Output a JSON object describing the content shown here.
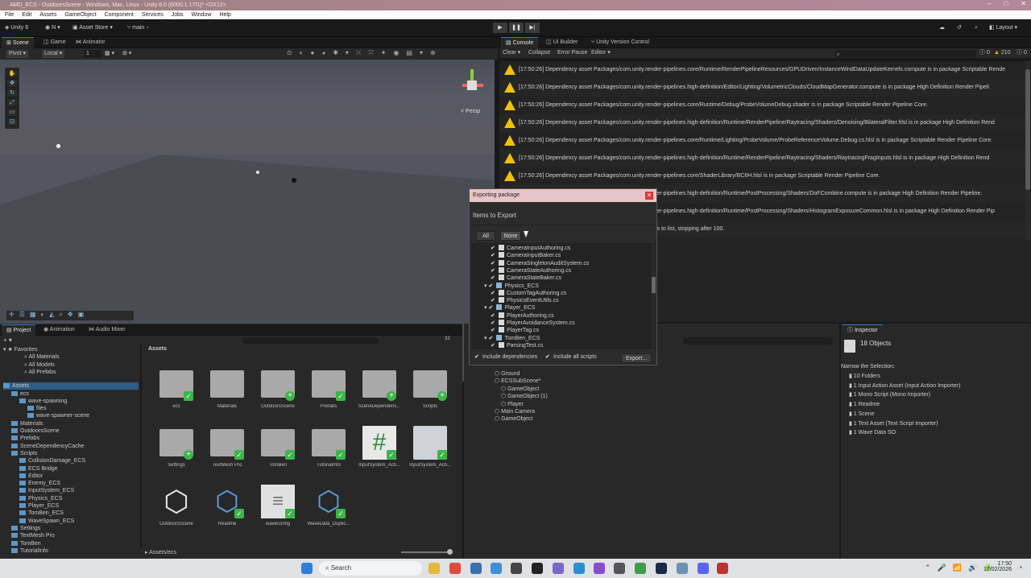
{
  "window": {
    "title": "AMD_ECS - OutdoorsScene - Windows, Mac, Linux - Unity 6.0 (6000.1.17f1)* <DX12>"
  },
  "menu": [
    "File",
    "Edit",
    "Assets",
    "GameObject",
    "Component",
    "Services",
    "Jobs",
    "Window",
    "Help"
  ],
  "toolbar": {
    "unity": "Unity 6",
    "account": "N",
    "asset_store": "Asset Store",
    "branch": "main",
    "layout": "Layout"
  },
  "scene_tabs": [
    "Scene",
    "Game",
    "Animator"
  ],
  "scene_toolbar": {
    "pivot": "Pivot",
    "local": "Local",
    "grid": "1",
    "persp": "< Persp"
  },
  "console": {
    "tabs": [
      "Console",
      "UI Builder",
      "Unity Version Control"
    ],
    "buttons": [
      "Clear",
      "Collapse",
      "Error Pause",
      "Editor"
    ],
    "counts": {
      "info": "0",
      "warn": "210",
      "error": "0"
    },
    "logs": [
      "[17:50:26] Dependency asset Packages/com.unity.render-pipelines.core/Runtime/RenderPipelineResources/GPUDriven/InstanceWindDataUpdateKernels.compute is in package Scriptable Rende",
      "[17:50:26] Dependency asset Packages/com.unity.render-pipelines.high-definition/Editor/Lighting/VolumetricClouds/CloudMapGenerator.compute is in package High Definition Render Pipeli",
      "[17:50:26] Dependency asset Packages/com.unity.render-pipelines.core/Runtime/Debug/ProbeVolumeDebug.shader is in package Scriptable Render Pipeline Core.",
      "[17:50:26] Dependency asset Packages/com.unity.render-pipelines.high-definition/Runtime/RenderPipeline/Raytracing/Shaders/Denoising/BilateralFilter.hlsl is in package High Definition Rend",
      "[17:50:26] Dependency asset Packages/com.unity.render-pipelines.core/Runtime/Lighting/ProbeVolume/ProbeReferenceVolume.Debug.cs.hlsl is in package Scriptable Render Pipeline Core.",
      "[17:50:26] Dependency asset Packages/com.unity.render-pipelines.high-definition/Runtime/RenderPipeline/Raytracing/Shaders/RaytracingFragInputs.hlsl is in package High Definition Rend",
      "[17:50:26] Dependency asset Packages/com.unity.render-pipelines.core/ShaderLibrary/BC6H.hlsl is in package Scriptable Render Pipeline Core.",
      "[17:50:26] Dependency asset Packages/com.unity.render-pipelines.high-definition/Runtime/PostProcessing/Shaders/DoFCombine.compute is in package High Definition Render Pipeline.",
      "[17:50:26] Dependency asset Packages/com.unity.render-pipelines.high-definition/Runtime/PostProcessing/Shaders/HistogramExposureCommon.hlsl is in package High Definition Render Pip",
      "[17:50:26] Dependency asset ... too many dependencies to list, stopping after 100."
    ]
  },
  "dialog": {
    "title": "Exporting package",
    "heading": "Items to Export",
    "all": "All",
    "none": "None",
    "rows": [
      {
        "label": "CameraInputAuthoring.cs",
        "indent": 3,
        "folder": false
      },
      {
        "label": "CameraInputBaker.cs",
        "indent": 3,
        "folder": false
      },
      {
        "label": "CameraSingletonAuditSystem.cs",
        "indent": 3,
        "folder": false
      },
      {
        "label": "CameraStateAuthoring.cs",
        "indent": 3,
        "folder": false
      },
      {
        "label": "CameraStateBaker.cs",
        "indent": 3,
        "folder": false
      },
      {
        "label": "Physics_ECS",
        "indent": 2,
        "folder": true
      },
      {
        "label": "CustomTagAuthoring.cs",
        "indent": 3,
        "folder": false
      },
      {
        "label": "PhysicsEventUtils.cs",
        "indent": 3,
        "folder": false
      },
      {
        "label": "Player_ECS",
        "indent": 2,
        "folder": true
      },
      {
        "label": "PlayerAuthoring.cs",
        "indent": 3,
        "folder": false
      },
      {
        "label": "PlayerAvoidanceSystem.cs",
        "indent": 3,
        "folder": false
      },
      {
        "label": "PlayerTag.cs",
        "indent": 3,
        "folder": false
      },
      {
        "label": "TomBen_ECS",
        "indent": 2,
        "folder": true
      },
      {
        "label": "ParsingTest.cs",
        "indent": 3,
        "folder": false
      }
    ],
    "include_deps": "Include dependencies",
    "include_scripts": "Include all scripts",
    "export": "Export..."
  },
  "project": {
    "tabs": [
      "Project",
      "Animation",
      "Audio Mixer"
    ],
    "favorites": "Favorites",
    "fav_items": [
      "All Materials",
      "All Models",
      "All Prefabs"
    ],
    "tree": [
      {
        "label": "Assets",
        "indent": 0
      },
      {
        "label": "ecs",
        "indent": 1
      },
      {
        "label": "wave-spawning",
        "indent": 2
      },
      {
        "label": "files",
        "indent": 3
      },
      {
        "label": "wave-spawner-scene",
        "indent": 3
      },
      {
        "label": "Materials",
        "indent": 1
      },
      {
        "label": "OutdoorsScene",
        "indent": 1
      },
      {
        "label": "Prefabs",
        "indent": 1
      },
      {
        "label": "SceneDependencyCache",
        "indent": 1
      },
      {
        "label": "Scripts",
        "indent": 1
      },
      {
        "label": "CollisionDamage_ECS",
        "indent": 2
      },
      {
        "label": "ECS Bridge",
        "indent": 2
      },
      {
        "label": "Editor",
        "indent": 2
      },
      {
        "label": "Enemy_ECS",
        "indent": 2
      },
      {
        "label": "InputSystem_ECS",
        "indent": 2
      },
      {
        "label": "Physics_ECS",
        "indent": 2
      },
      {
        "label": "Player_ECS",
        "indent": 2
      },
      {
        "label": "TomBen_ECS",
        "indent": 2
      },
      {
        "label": "WaveSpawn_ECS",
        "indent": 2
      },
      {
        "label": "Settings",
        "indent": 1
      },
      {
        "label": "TextMesh Pro",
        "indent": 1
      },
      {
        "label": "TomBen",
        "indent": 1
      },
      {
        "label": "TutorialInfo",
        "indent": 1
      }
    ],
    "breadcrumb": "Assets",
    "footer_path": "Assets/ecs",
    "count": "32",
    "assets": [
      {
        "label": "ecs",
        "kind": "folder",
        "badge": "chk"
      },
      {
        "label": "Materials",
        "kind": "folder",
        "badge": ""
      },
      {
        "label": "OutdoorsScene",
        "kind": "folder",
        "badge": "plus"
      },
      {
        "label": "Prefabs",
        "kind": "folder",
        "badge": "chk"
      },
      {
        "label": "SceneDependenc...",
        "kind": "folder",
        "badge": "plus"
      },
      {
        "label": "Scripts",
        "kind": "folder",
        "badge": "plus"
      },
      {
        "label": "Settings",
        "kind": "folder",
        "badge": "plus"
      },
      {
        "label": "TextMesh Pro",
        "kind": "folder",
        "badge": "chk"
      },
      {
        "label": "TomBen",
        "kind": "folder",
        "badge": "chk"
      },
      {
        "label": "TutorialInfo",
        "kind": "folder",
        "badge": "chk"
      },
      {
        "label": "InputSystem_Acti...",
        "kind": "script",
        "badge": "chk"
      },
      {
        "label": "InputSystem_Acti...",
        "kind": "input",
        "badge": "chk"
      },
      {
        "label": "OutdoorsScene",
        "kind": "unity",
        "badge": ""
      },
      {
        "label": "Readme",
        "kind": "so",
        "badge": "chk"
      },
      {
        "label": "waveconfig",
        "kind": "text",
        "badge": "chk"
      },
      {
        "label": "WaveData_Duplic...",
        "kind": "so",
        "badge": "chk"
      }
    ]
  },
  "hierarchy": {
    "items": [
      {
        "label": "Ground",
        "indent": 1
      },
      {
        "label": "ECSSubScene*",
        "indent": 1
      },
      {
        "label": "GameObject",
        "indent": 2
      },
      {
        "label": "GameObject (1)",
        "indent": 2
      },
      {
        "label": "Player",
        "indent": 2
      },
      {
        "label": "Main Camera",
        "indent": 1
      },
      {
        "label": "GameObject",
        "indent": 1
      }
    ]
  },
  "inspector": {
    "tab": "Inspector",
    "title": "18 Objects",
    "narrow": "Narrow the Selection:",
    "items": [
      "10 Folders",
      "1 Input Action Asset (Input Action Importer)",
      "1 Mono Script (Mono Importer)",
      "1 Readme",
      "1 Scene",
      "1 Text Asset (Text Script Importer)",
      "1 Wave Data SO"
    ]
  },
  "taskbar": {
    "search": "Search",
    "time": "17:50",
    "date": "17/02/2026"
  }
}
